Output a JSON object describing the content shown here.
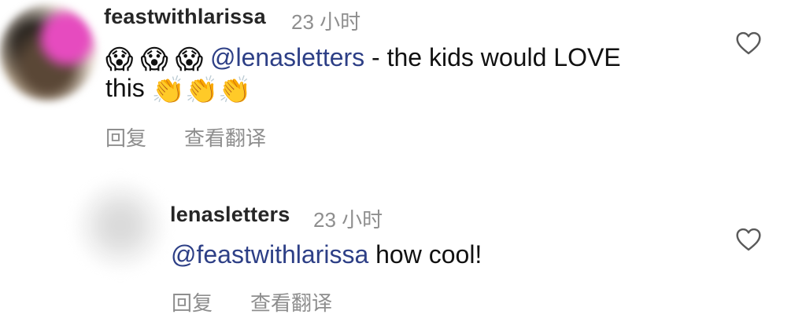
{
  "comments": [
    {
      "username": "feastwithlarissa",
      "time": "23 小时",
      "mention": "@lenasletters",
      "text_after_mention": " - the kids would LOVE",
      "text_line2": "this",
      "emojis_before": [
        "😱",
        "😱",
        "😱"
      ],
      "emojis_after": [
        "👏",
        "👏",
        "👏"
      ],
      "reply_label": "回复",
      "translate_label": "查看翻译",
      "like_icon": "heart-outline-icon"
    },
    {
      "username": "lenasletters",
      "time": "23 小时",
      "mention": "@feastwithlarissa",
      "text_after_mention": " how cool!",
      "reply_label": "回复",
      "translate_label": "查看翻译",
      "like_icon": "heart-outline-icon"
    }
  ],
  "colors": {
    "username": "#262626",
    "meta": "#8e8e8e",
    "mention": "#2d3f86",
    "text": "#111111"
  }
}
